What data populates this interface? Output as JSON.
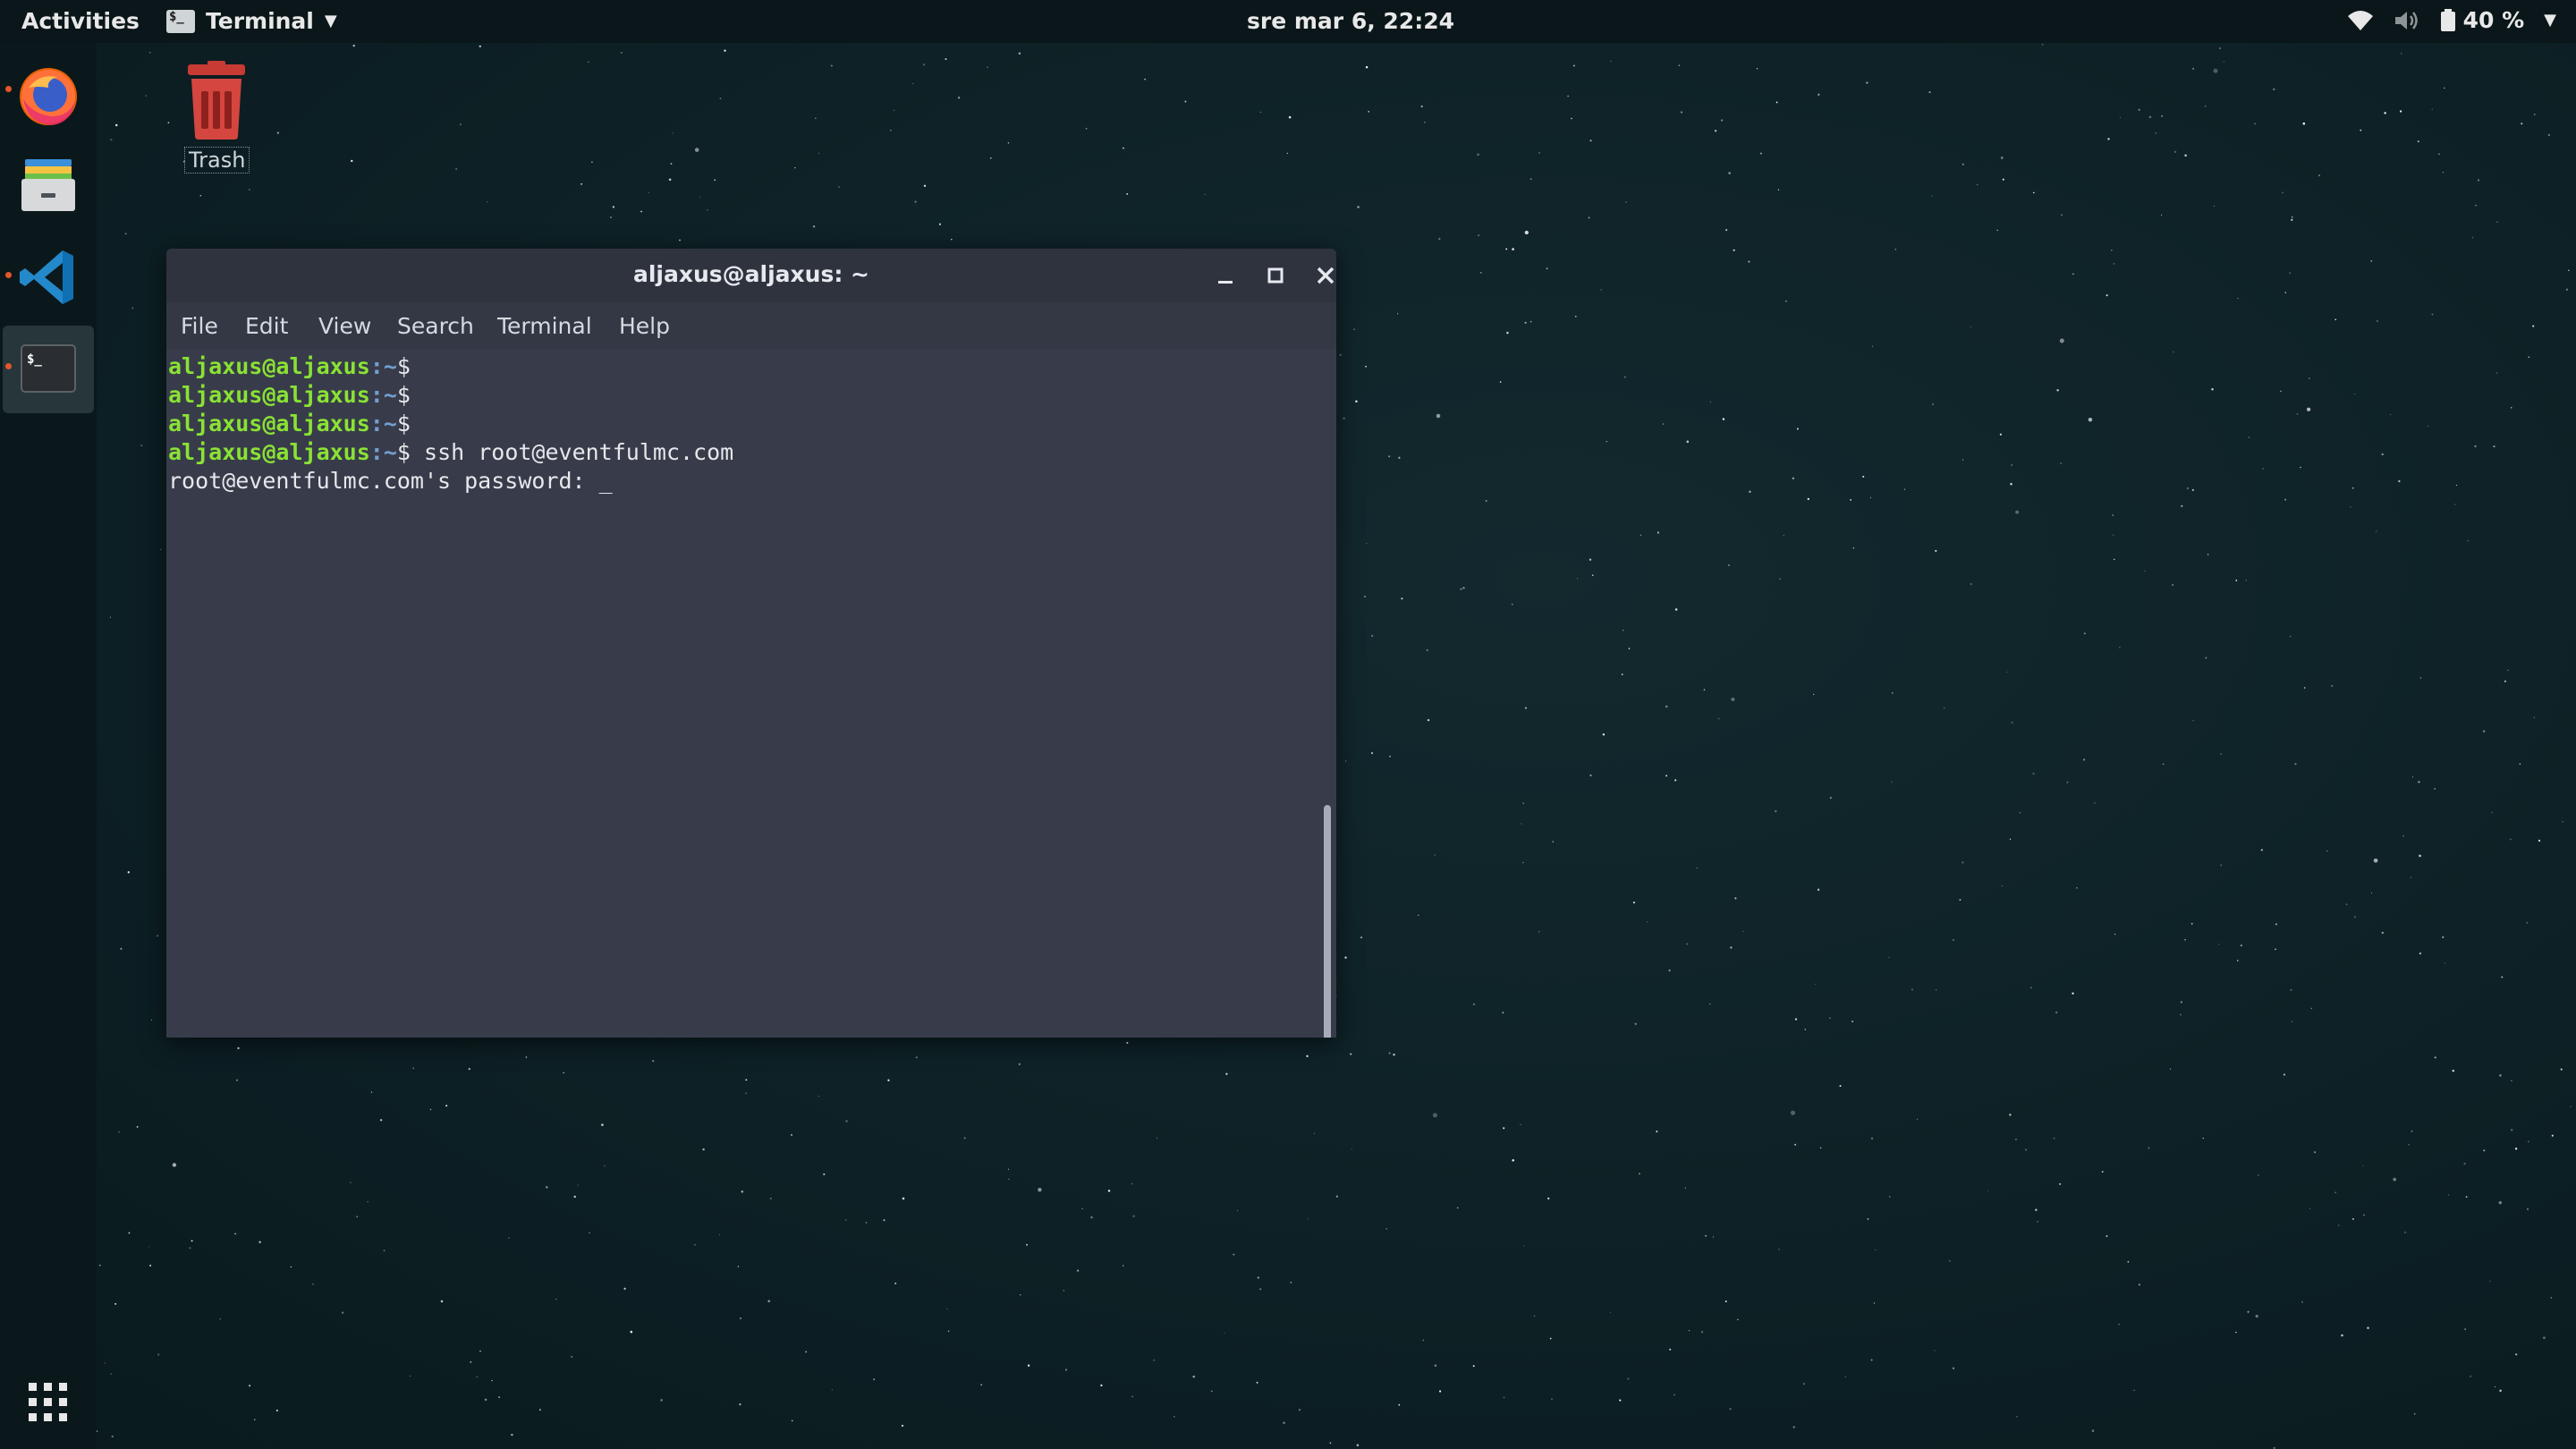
{
  "topbar": {
    "activities": "Activities",
    "app_name": "Terminal",
    "clock": "sre mar  6, 22:24",
    "battery": "40 %"
  },
  "desktop": {
    "trash_label": "Trash"
  },
  "window": {
    "title": "aljaxus@aljaxus: ~",
    "menu": [
      "File",
      "Edit",
      "View",
      "Search",
      "Terminal",
      "Help"
    ]
  },
  "terminal": {
    "user_host": "aljaxus@aljaxus",
    "colon": ":",
    "path": "~",
    "dollar": "$",
    "command": " ssh root@eventfulmc.com",
    "password_prompt": "root@eventfulmc.com's password: _"
  },
  "icons": {
    "dock": [
      "firefox-icon",
      "files-icon",
      "vscode-icon",
      "terminal-icon",
      "show-apps-icon"
    ],
    "tray": [
      "wifi-icon",
      "volume-icon",
      "battery-icon"
    ]
  },
  "colors": {
    "prompt_user": "#8ae234",
    "prompt_path": "#729fcf",
    "terminal_bg": "#383c4a",
    "titlebar_bg": "#2f333d",
    "topbar_bg": "#0a1619"
  }
}
